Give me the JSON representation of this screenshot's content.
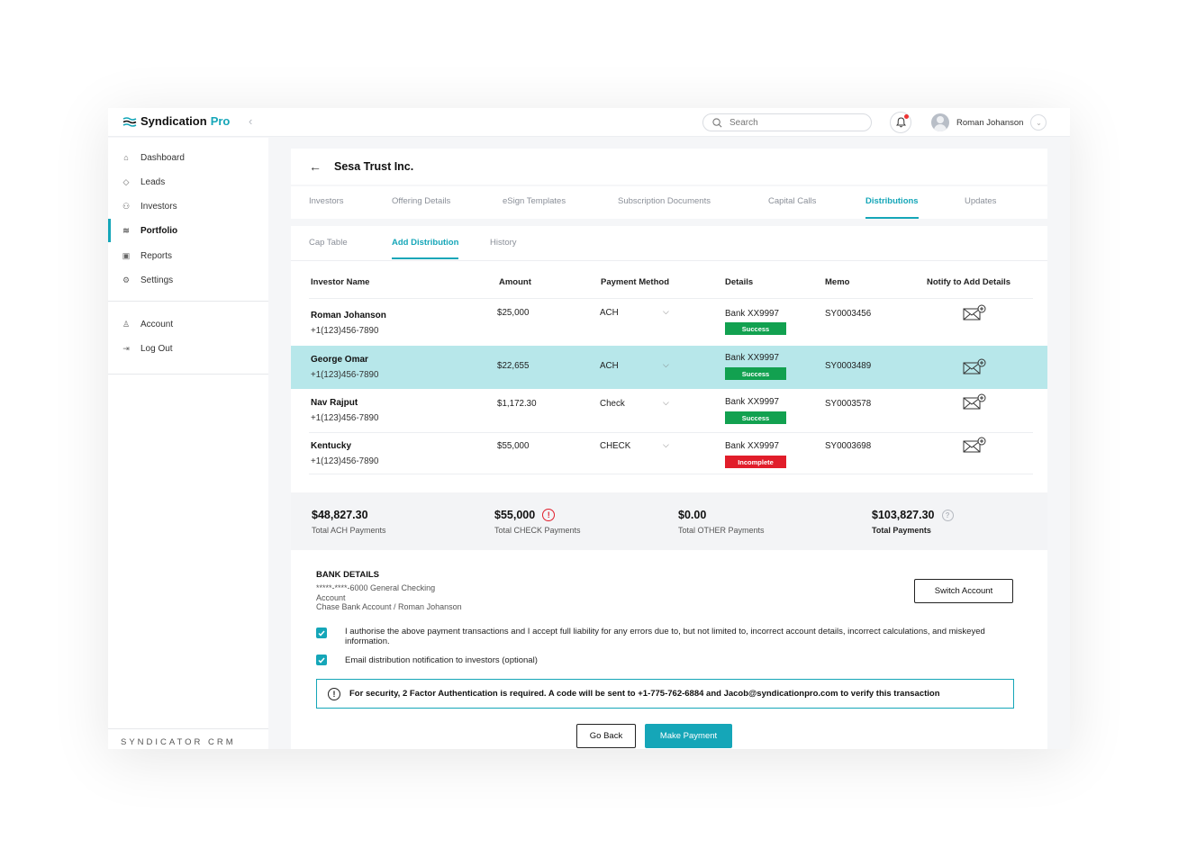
{
  "app": {
    "brand_main": "Syndication",
    "brand_accent": "Pro",
    "search_placeholder": "Search",
    "user_name": "Roman Johanson",
    "footer_label": "SYNDICATOR CRM",
    "accent_color": "#15a6b8"
  },
  "sidebar": {
    "items": [
      {
        "label": "Dashboard",
        "icon": "home-icon"
      },
      {
        "label": "Leads",
        "icon": "tag-icon"
      },
      {
        "label": "Investors",
        "icon": "users-icon"
      },
      {
        "label": "Portfolio",
        "icon": "layers-icon",
        "active": true
      },
      {
        "label": "Reports",
        "icon": "chart-icon"
      },
      {
        "label": "Settings",
        "icon": "gear-icon"
      }
    ],
    "account_items": [
      {
        "label": "Account",
        "icon": "user-icon"
      },
      {
        "label": "Log Out",
        "icon": "logout-icon"
      }
    ]
  },
  "page": {
    "title": "Sesa Trust Inc.",
    "tabs": [
      "Investors",
      "Offering Details",
      "eSign Templates",
      "Subscription Documents",
      "Capital Calls",
      "Distributions",
      "Updates"
    ],
    "active_tab": "Distributions",
    "subtabs": [
      "Cap Table",
      "Add Distribution",
      "History"
    ],
    "active_subtab": "Add Distribution"
  },
  "table": {
    "headers": [
      "Investor Name",
      "Amount",
      "Payment Method",
      "Details",
      "Memo",
      "Notify to Add Details"
    ],
    "rows": [
      {
        "name": "Roman Johanson",
        "phone": "+1(123)456-7890",
        "amount": "$25,000",
        "method": "ACH",
        "bank": "Bank XX9997",
        "status": "Success",
        "memo": "SY0003456"
      },
      {
        "name": "George Omar",
        "phone": "+1(123)456-7890",
        "amount": "$22,655",
        "method": "ACH",
        "bank": "Bank XX9997",
        "status": "Success",
        "memo": "SY0003489"
      },
      {
        "name": "Nav Rajput",
        "phone": "+1(123)456-7890",
        "amount": "$1,172.30",
        "method": "Check",
        "bank": "Bank XX9997",
        "status": "Success",
        "memo": "SY0003578"
      },
      {
        "name": "Kentucky",
        "phone": "+1(123)456-7890",
        "amount": "$55,000",
        "method": "CHECK",
        "bank": "Bank XX9997",
        "status": "Incomplete",
        "memo": "SY0003698"
      }
    ]
  },
  "summary": {
    "ach": {
      "amount": "$48,827.30",
      "label": "Total ACH Payments"
    },
    "check": {
      "amount": "$55,000",
      "label": "Total CHECK Payments"
    },
    "other": {
      "amount": "$0.00",
      "label": "Total OTHER Payments"
    },
    "total": {
      "amount": "$103,827.30",
      "label": "Total Payments"
    }
  },
  "bank": {
    "title": "BANK DETAILS",
    "line1": "*****-****-6000 General Checking",
    "line2": "Account",
    "line3": "Chase Bank Account / Roman Johanson",
    "switch_label": "Switch Account"
  },
  "consent": {
    "authorise": "I authorise the above payment transactions and I accept full liability for any errors due to, but not limited to, incorrect account details, incorrect calculations, and miskeyed information.",
    "email_notify": "Email distribution notification to investors (optional)"
  },
  "security_notice": "For security, 2 Factor Authentication is required. A code will be sent to +1-775-762-6884 and Jacob@syndicationpro.com to verify this transaction",
  "actions": {
    "go_back": "Go Back",
    "make_payment": "Make Payment"
  }
}
